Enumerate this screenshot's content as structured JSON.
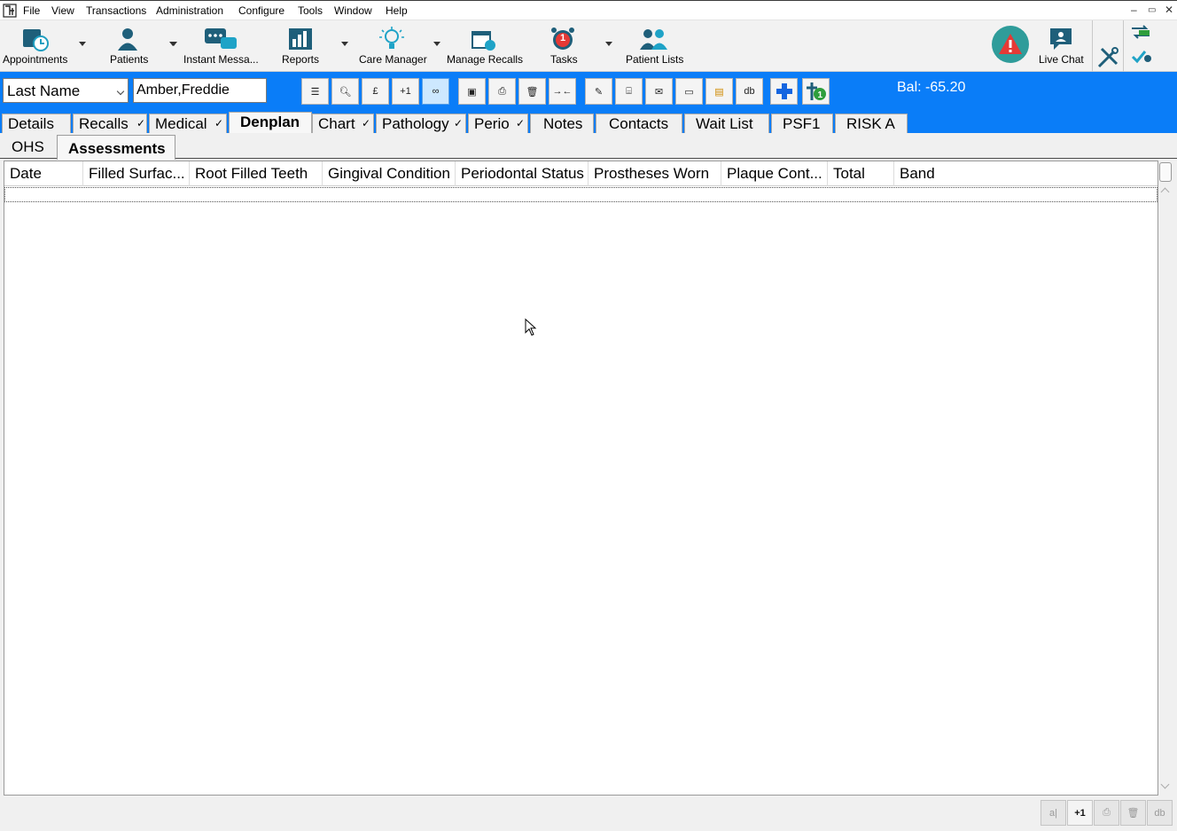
{
  "menu": [
    "File",
    "View",
    "Transactions",
    "Administration",
    "Configure",
    "Tools",
    "Window",
    "Help"
  ],
  "window_controls": [
    "–",
    "▭",
    "✕"
  ],
  "ribbon": {
    "appointments": "Appointments",
    "patients": "Patients",
    "instant_messaging": "Instant Messa...",
    "reports": "Reports",
    "care_manager": "Care Manager",
    "manage_recalls": "Manage Recalls",
    "tasks": "Tasks",
    "tasks_badge": "1",
    "patient_lists": "Patient Lists",
    "live_chat": "Live Chat"
  },
  "patient_bar": {
    "search_type": "Last Name",
    "patient_name": "Amber,Freddie",
    "balance": "Bal: -65.20",
    "toolbar_icons": [
      "list-icon",
      "search-icon",
      "pound-icon",
      "plus-one-icon",
      "link-icon",
      "save-icon",
      "print-icon",
      "delete-icon",
      "merge-icon",
      "edit-icon",
      "scan-icon",
      "letter-icon",
      "card-icon",
      "notes-icon",
      "database-icon",
      "medical-cross-icon",
      "add-patient-icon"
    ]
  },
  "tabs": [
    {
      "label": "Details",
      "tick": ""
    },
    {
      "label": "Recalls",
      "tick": "✓"
    },
    {
      "label": "Medical",
      "tick": "✓"
    },
    {
      "label": "Denplan",
      "tick": ""
    },
    {
      "label": "Chart",
      "tick": "✓"
    },
    {
      "label": "Pathology",
      "tick": "✓"
    },
    {
      "label": "Perio",
      "tick": "✓"
    },
    {
      "label": "Notes",
      "tick": ""
    },
    {
      "label": "Contacts",
      "tick": ""
    },
    {
      "label": "Wait List",
      "tick": ""
    },
    {
      "label": "PSF1",
      "tick": ""
    },
    {
      "label": "RISK A",
      "tick": ""
    }
  ],
  "selected_tab": "Denplan",
  "subtabs": [
    "OHS",
    "Assessments"
  ],
  "selected_subtab": "Assessments",
  "grid": {
    "columns": [
      "Date",
      "Filled Surfac...",
      "Root Filled Teeth",
      "Gingival Condition",
      "Periodontal Status",
      "Prostheses Worn",
      "Plaque Cont...",
      "Total",
      "Band"
    ],
    "rows": []
  },
  "bottom_buttons": [
    {
      "icon": "split-icon",
      "label": "a|",
      "enabled": false
    },
    {
      "icon": "plus-one-icon",
      "label": "+1",
      "enabled": true
    },
    {
      "icon": "print-icon",
      "label": "⎙",
      "enabled": false
    },
    {
      "icon": "delete-icon",
      "label": "🗑",
      "enabled": false
    },
    {
      "icon": "database-icon",
      "label": "db",
      "enabled": false
    }
  ],
  "colors": {
    "accent_blue": "#0a7df8",
    "alert_red": "#e53935"
  }
}
